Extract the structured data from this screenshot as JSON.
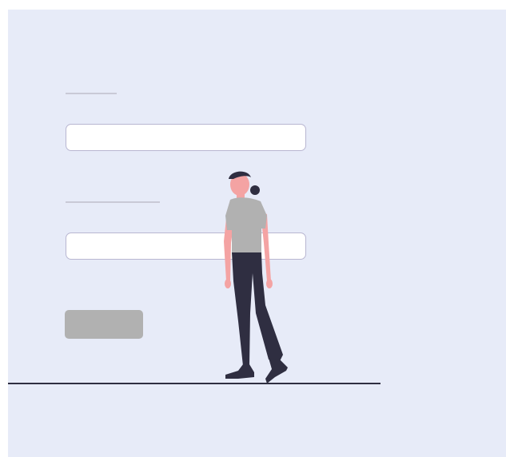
{
  "illustration": {
    "subject": "person-walking-icon",
    "colors": {
      "background": "#e7ebf8",
      "field_border": "#b8b6d1",
      "label_placeholder": "#c9c9d6",
      "button": "#b1b1b1",
      "skin": "#f4a3a3",
      "hair": "#2f2e41",
      "shirt": "#b1b1b1",
      "pants": "#2f2e41",
      "ground": "#2f2e41"
    }
  },
  "form": {
    "field_1_label": "",
    "field_1_value": "",
    "field_2_label": "",
    "field_2_value": "",
    "submit_label": ""
  }
}
